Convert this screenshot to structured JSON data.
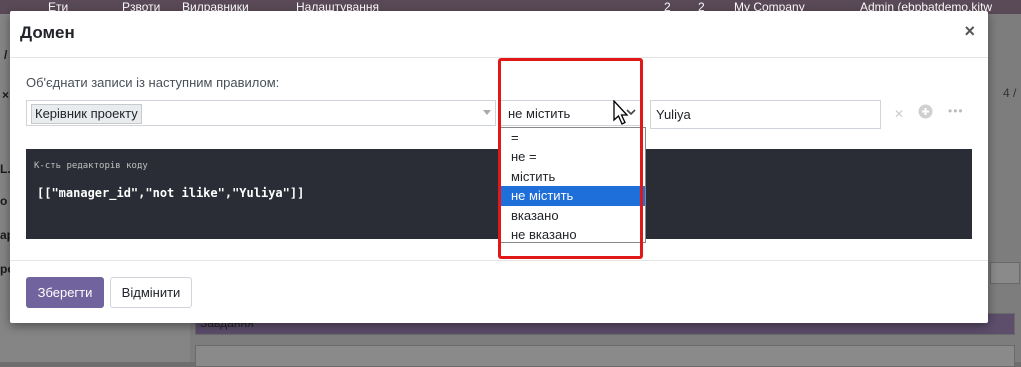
{
  "background": {
    "nav_items": [
      "Ети",
      "Рзвоти",
      "Вилравники",
      "Налаштування"
    ],
    "badges": [
      "2",
      "2"
    ],
    "company": "My Company",
    "user": "Admin (ebpbatdemo.kitw",
    "pager": "4 /",
    "task_select": "Завдання",
    "fragments": [
      "/",
      "L.",
      "о",
      "ар",
      "ро",
      "×"
    ]
  },
  "modal": {
    "title": "Домен",
    "close": "×",
    "rule_label": "Об'єднати записи із наступним правилом:",
    "field_value": "Керівник проекту",
    "operator_value": "не містить",
    "input_value": "Yuliya",
    "code_label": "К-сть редакторів коду",
    "code": "[[\"manager_id\",\"not ilike\",\"Yuliya\"]]",
    "operators": [
      "=",
      "не =",
      "містить",
      "не містить",
      "вказано",
      "не вказано"
    ],
    "selected_operator_index": 3,
    "save_label": "Зберегти",
    "cancel_label": "Відмінити"
  },
  "icons": {
    "delete_rule": "close-icon",
    "add_rule": "plus-circle-icon",
    "more": "ellipsis-icon",
    "operator_caret": "chevron-down-icon",
    "cursor": "mouse-pointer-icon"
  },
  "colors": {
    "primary": "#71639e",
    "selected_option": "#1e6fd9",
    "highlight": "#e11818",
    "code_bg": "#2a2d35"
  }
}
